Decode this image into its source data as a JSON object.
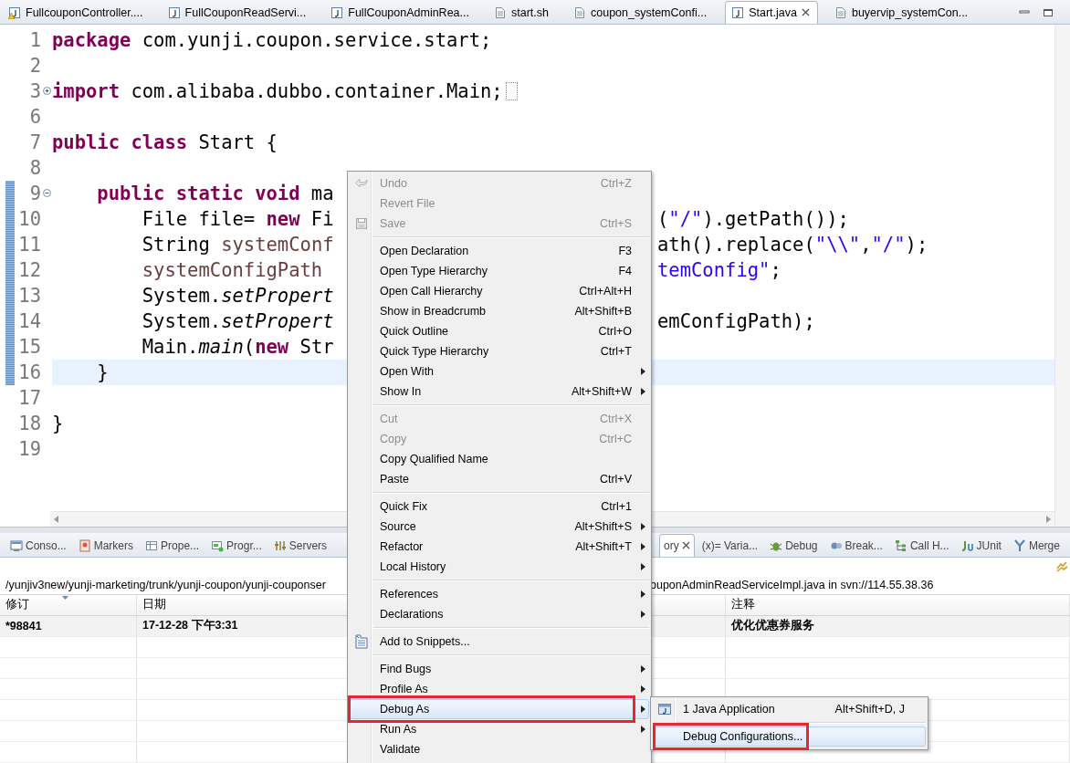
{
  "editor_tabs": [
    {
      "label": "FullcouponController....",
      "selected": false,
      "closable": false
    },
    {
      "label": "FullCouponReadServi...",
      "selected": false,
      "closable": false
    },
    {
      "label": "FullCouponAdminRea...",
      "selected": false,
      "closable": false
    },
    {
      "label": "start.sh",
      "selected": false,
      "closable": false
    },
    {
      "label": "coupon_systemConfi...",
      "selected": false,
      "closable": false
    },
    {
      "label": "Start.java",
      "selected": true,
      "closable": true
    },
    {
      "label": "buyervip_systemCon...",
      "selected": false,
      "closable": false
    }
  ],
  "editor": {
    "lines": [
      {
        "number": "1",
        "segments": [
          {
            "kind": "keyword",
            "text": "package"
          },
          {
            "kind": "plain",
            "text": " com.yunji.coupon.service.start;"
          }
        ]
      },
      {
        "number": "2"
      },
      {
        "number": "3",
        "collapsed": true,
        "segments": [
          {
            "kind": "keyword",
            "text": "import"
          },
          {
            "kind": "plain",
            "text": " com.alibaba.dubbo.container.Main;"
          }
        ]
      },
      {
        "number": "6"
      },
      {
        "number": "7",
        "segments": [
          {
            "kind": "keyword",
            "text": "public class"
          },
          {
            "kind": "plain",
            "text": " Start {"
          }
        ]
      },
      {
        "number": "8"
      },
      {
        "number": "9",
        "collapsed": false,
        "changed": true,
        "segments": [
          {
            "kind": "keyword",
            "text": "    public static void"
          },
          {
            "kind": "plain",
            "text": " ma"
          }
        ]
      },
      {
        "number": "10",
        "changed": true,
        "segments": [
          {
            "kind": "plain",
            "text": "        File file= "
          },
          {
            "kind": "keyword",
            "text": "new"
          },
          {
            "kind": "plain",
            "text": " Fi"
          }
        ],
        "right": [
          {
            "kind": "plain",
            "text": "("
          },
          {
            "kind": "string",
            "text": "\"/\""
          },
          {
            "kind": "plain",
            "text": ").getPath());"
          }
        ]
      },
      {
        "number": "11",
        "changed": true,
        "segments": [
          {
            "kind": "plain",
            "text": "        String "
          },
          {
            "kind": "local",
            "text": "systemConf"
          }
        ],
        "right": [
          {
            "kind": "plain",
            "text": "ath().replace("
          },
          {
            "kind": "string",
            "text": "\"\\\\\""
          },
          {
            "kind": "plain",
            "text": ","
          },
          {
            "kind": "string",
            "text": "\"/\""
          },
          {
            "kind": "plain",
            "text": ");"
          }
        ]
      },
      {
        "number": "12",
        "changed": true,
        "segments": [
          {
            "kind": "local",
            "text": "        systemConfigPath"
          }
        ],
        "right": [
          {
            "kind": "string",
            "text": "temConfig\""
          },
          {
            "kind": "plain",
            "text": ";"
          }
        ]
      },
      {
        "number": "13",
        "changed": true,
        "segments": [
          {
            "kind": "plain",
            "text": "        System."
          },
          {
            "kind": "italic",
            "text": "setPropert"
          }
        ]
      },
      {
        "number": "14",
        "changed": true,
        "segments": [
          {
            "kind": "plain",
            "text": "        System."
          },
          {
            "kind": "italic",
            "text": "setPropert"
          }
        ],
        "right": [
          {
            "kind": "plain",
            "text": "emConfigPath);"
          }
        ]
      },
      {
        "number": "15",
        "changed": true,
        "segments": [
          {
            "kind": "plain",
            "text": "        Main."
          },
          {
            "kind": "italic",
            "text": "main"
          },
          {
            "kind": "plain",
            "text": "("
          },
          {
            "kind": "keyword",
            "text": "new"
          },
          {
            "kind": "plain",
            "text": " Str"
          }
        ]
      },
      {
        "number": "16",
        "changed": true,
        "current": true,
        "segments": [
          {
            "kind": "plain",
            "text": "    }"
          }
        ]
      },
      {
        "number": "17"
      },
      {
        "number": "18",
        "segments": [
          {
            "kind": "plain",
            "text": "}"
          }
        ]
      },
      {
        "number": "19"
      }
    ]
  },
  "bottom_panel": {
    "tabs_left": [
      {
        "label": "Conso...",
        "selected": false
      },
      {
        "label": "Markers",
        "selected": false
      },
      {
        "label": "Prope...",
        "selected": false
      },
      {
        "label": "Progr...",
        "selected": false
      },
      {
        "label": "Servers",
        "selected": false
      }
    ],
    "tabs_right": [
      {
        "label": "ory",
        "selected": true,
        "closable": true
      },
      {
        "label": "(x)= Varia...",
        "selected": false,
        "closable": false
      },
      {
        "label": "Debug",
        "selected": false,
        "closable": false
      },
      {
        "label": "Break...",
        "selected": false,
        "closable": false
      },
      {
        "label": "Call H...",
        "selected": false,
        "closable": false
      },
      {
        "label": "JUnit",
        "selected": false,
        "closable": false
      },
      {
        "label": "Merge",
        "selected": false,
        "closable": false
      }
    ],
    "path_left": "/yunjiv3new/yunji-marketing/trunk/yunji-coupon/yunji-couponser",
    "path_right": "ouponAdminReadServiceImpl.java in svn://114.55.38.36",
    "table": {
      "columns": [
        "修订",
        "日期",
        "注释"
      ],
      "rows": [
        {
          "cells": [
            "*98841",
            "17-12-28 下午3:31",
            "优化优惠券服务"
          ],
          "current": true
        }
      ]
    }
  },
  "context_menu": {
    "items": [
      {
        "kind": "item",
        "label": "Undo",
        "shortcut": "Ctrl+Z",
        "disabled": true
      },
      {
        "kind": "item",
        "label": "Revert File",
        "disabled": true
      },
      {
        "kind": "item",
        "label": "Save",
        "shortcut": "Ctrl+S",
        "disabled": true
      },
      {
        "kind": "separator"
      },
      {
        "kind": "item",
        "label": "Open Declaration",
        "shortcut": "F3",
        "disabled": false
      },
      {
        "kind": "item",
        "label": "Open Type Hierarchy",
        "shortcut": "F4",
        "disabled": false
      },
      {
        "kind": "item",
        "label": "Open Call Hierarchy",
        "shortcut": "Ctrl+Alt+H",
        "disabled": false
      },
      {
        "kind": "item",
        "label": "Show in Breadcrumb",
        "shortcut": "Alt+Shift+B",
        "disabled": false
      },
      {
        "kind": "item",
        "label": "Quick Outline",
        "shortcut": "Ctrl+O",
        "disabled": false
      },
      {
        "kind": "item",
        "label": "Quick Type Hierarchy",
        "shortcut": "Ctrl+T",
        "disabled": false
      },
      {
        "kind": "item",
        "label": "Open With",
        "disabled": false,
        "submenu": true
      },
      {
        "kind": "item",
        "label": "Show In",
        "shortcut": "Alt+Shift+W",
        "disabled": false,
        "submenu": true
      },
      {
        "kind": "separator"
      },
      {
        "kind": "item",
        "label": "Cut",
        "shortcut": "Ctrl+X",
        "disabled": true
      },
      {
        "kind": "item",
        "label": "Copy",
        "shortcut": "Ctrl+C",
        "disabled": true
      },
      {
        "kind": "item",
        "label": "Copy Qualified Name",
        "disabled": false
      },
      {
        "kind": "item",
        "label": "Paste",
        "shortcut": "Ctrl+V",
        "disabled": false
      },
      {
        "kind": "separator"
      },
      {
        "kind": "item",
        "label": "Quick Fix",
        "shortcut": "Ctrl+1",
        "disabled": false
      },
      {
        "kind": "item",
        "label": "Source",
        "shortcut": "Alt+Shift+S",
        "disabled": false,
        "submenu": true
      },
      {
        "kind": "item",
        "label": "Refactor",
        "shortcut": "Alt+Shift+T",
        "disabled": false,
        "submenu": true
      },
      {
        "kind": "item",
        "label": "Local History",
        "disabled": false,
        "submenu": true
      },
      {
        "kind": "separator"
      },
      {
        "kind": "item",
        "label": "References",
        "disabled": false,
        "submenu": true
      },
      {
        "kind": "item",
        "label": "Declarations",
        "disabled": false,
        "submenu": true
      },
      {
        "kind": "separator"
      },
      {
        "kind": "item",
        "label": "Add to Snippets...",
        "disabled": false
      },
      {
        "kind": "separator"
      },
      {
        "kind": "item",
        "label": "Find Bugs",
        "disabled": false,
        "submenu": true
      },
      {
        "kind": "item",
        "label": "Profile As",
        "disabled": false,
        "submenu": true
      },
      {
        "kind": "item",
        "label": "Debug As",
        "disabled": false,
        "submenu": true,
        "selected": true,
        "outlined": true
      },
      {
        "kind": "item",
        "label": "Run As",
        "disabled": false,
        "submenu": true
      },
      {
        "kind": "item",
        "label": "Validate",
        "disabled": false
      }
    ]
  },
  "submenu": {
    "items": [
      {
        "kind": "item",
        "label": "1 Java Application",
        "shortcut": "Alt+Shift+D, J",
        "selected": false,
        "outlined": false
      },
      {
        "kind": "separator"
      },
      {
        "kind": "item",
        "label": "Debug Configurations...",
        "selected": true,
        "outlined": true
      }
    ]
  }
}
